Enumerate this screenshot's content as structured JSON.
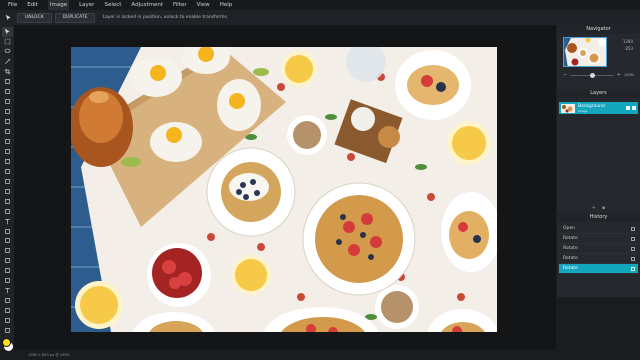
{
  "menu": [
    "File",
    "Edit",
    "Image",
    "Layer",
    "Select",
    "Adjustment",
    "Filter",
    "View",
    "Help"
  ],
  "options": {
    "unlock_label": "UNLOCK",
    "duplicate_label": "DUPLICATE",
    "message": "Layer is locked in position, unlock to enable transforms."
  },
  "tools": [
    "move-tool",
    "marquee-tool",
    "lasso-tool",
    "magic-wand-tool",
    "crop-tool",
    "slice-tool",
    "healing-tool",
    "patch-tool",
    "brush-tool",
    "pencil-tool",
    "clone-tool",
    "eraser-tool",
    "blur-tool",
    "dodge-tool",
    "sponge-tool",
    "pen-tool",
    "gradient-tool",
    "bucket-tool",
    "shape-tool",
    "type-tool",
    "eyedropper-tool",
    "hand-tool",
    "zoom-tool",
    "smudge-tool",
    "path-tool",
    "rectangle-tool",
    "text-tool",
    "fill-tool",
    "hand-tool-2",
    "zoom-tool-2",
    "dropper-tool"
  ],
  "colors": {
    "foreground": "#ffe31a",
    "background": "#ffffff",
    "accent": "#13a6bd"
  },
  "navigator": {
    "title": "Navigator",
    "width": "1280",
    "height": "853",
    "zoom": "100%",
    "zoom_level": 0.45
  },
  "layers": {
    "title": "Layers",
    "name": "Background",
    "sub": "Image"
  },
  "history": {
    "title": "History",
    "items": [
      "Open",
      "Rotate",
      "Rotate",
      "Rotate",
      "Rotate"
    ],
    "active_index": 4
  },
  "status": "1280 × 853 px @ 100%"
}
